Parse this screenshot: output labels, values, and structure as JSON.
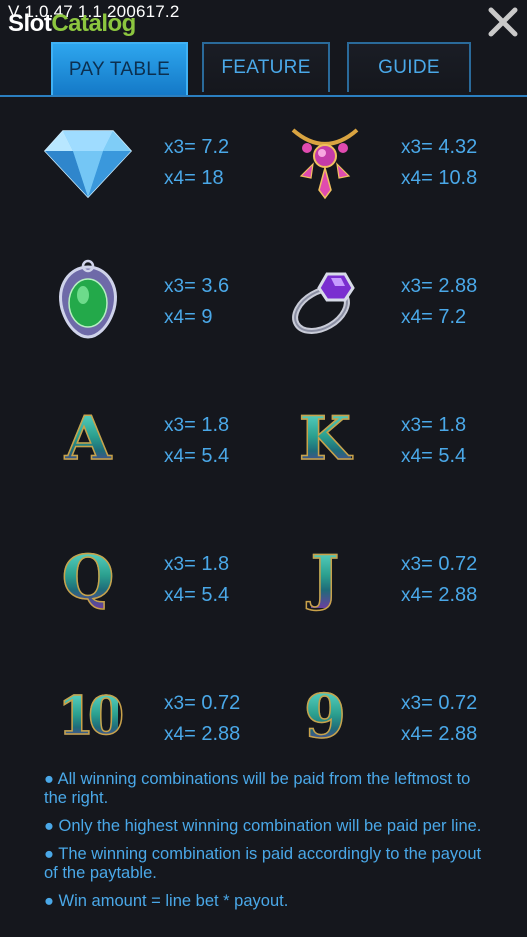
{
  "header": {
    "version": "V 1.0.47  1.1.200617.2",
    "watermark_part1": "Slot",
    "watermark_part2": "Catalog",
    "close_icon": "close-x-icon"
  },
  "tabs": [
    {
      "label": "PAY TABLE",
      "active": true
    },
    {
      "label": "FEATURE",
      "active": false
    },
    {
      "label": "GUIDE",
      "active": false
    }
  ],
  "paytable": [
    {
      "symbol": "diamond-icon",
      "x3": "x3",
      "v3": "= 7.2",
      "x4": "x4",
      "v4": "= 18"
    },
    {
      "symbol": "necklace-icon",
      "x3": "x3",
      "v3": "= 4.32",
      "x4": "x4",
      "v4": "= 10.8"
    },
    {
      "symbol": "emerald-pendant-icon",
      "x3": "x3",
      "v3": "= 3.6",
      "x4": "x4",
      "v4": "= 9"
    },
    {
      "symbol": "amethyst-ring-icon",
      "x3": "x3",
      "v3": "= 2.88",
      "x4": "x4",
      "v4": "= 7.2"
    },
    {
      "symbol": "A",
      "x3": "x3",
      "v3": "= 1.8",
      "x4": "x4",
      "v4": "= 5.4"
    },
    {
      "symbol": "K",
      "x3": "x3",
      "v3": "= 1.8",
      "x4": "x4",
      "v4": "= 5.4"
    },
    {
      "symbol": "Q",
      "x3": "x3",
      "v3": "= 1.8",
      "x4": "x4",
      "v4": "= 5.4"
    },
    {
      "symbol": "J",
      "x3": "x3",
      "v3": "= 0.72",
      "x4": "x4",
      "v4": "= 2.88"
    },
    {
      "symbol": "10",
      "x3": "x3",
      "v3": "= 0.72",
      "x4": "x4",
      "v4": "= 2.88"
    },
    {
      "symbol": "9",
      "x3": "x3",
      "v3": "= 0.72",
      "x4": "x4",
      "v4": "= 2.88"
    }
  ],
  "rules": [
    "● All winning combinations will be paid from the leftmost to the right.",
    "● Only the highest winning combination will be paid per line.",
    "● The winning combination is paid accordingly to the payout of the paytable.",
    "● Win amount = line bet * payout."
  ],
  "colors": {
    "background": "#15171d",
    "accent": "#4aa8e8",
    "active_tab": "#2ea6ee",
    "watermark_green": "#8cc63f"
  }
}
